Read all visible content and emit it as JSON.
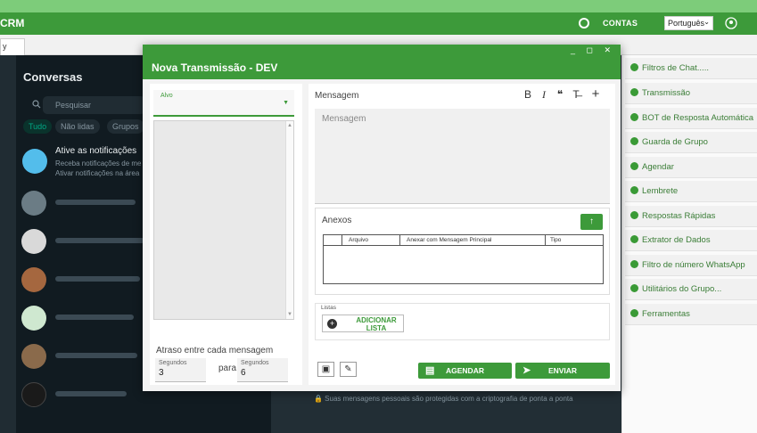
{
  "topbar": {
    "app_title": "CRM",
    "contas_label": "CONTAS",
    "language": "Português"
  },
  "tab": {
    "label": "y"
  },
  "whatsapp": {
    "title": "Conversas",
    "search_placeholder": "Pesquisar",
    "filters": [
      "Tudo",
      "Não lidas",
      "Grupos"
    ],
    "notification": {
      "title": "Ative as notificações",
      "line1": "Receba notificações de me",
      "line2": "Ativar notificações na área"
    },
    "privacy_note": "🔒 Suas mensagens pessoais são protegidas com a criptografia de ponta a ponta"
  },
  "modal": {
    "title": "Nova Transmissão - DEV",
    "window_controls": "_ ◻ ✕",
    "alvo_label": "Alvo",
    "delay_label": "Atraso entre cada mensagem",
    "delay_from_caption": "Segundos",
    "delay_from_value": "3",
    "delay_between": "para",
    "delay_to_caption": "Segundos",
    "delay_to_value": "6",
    "message_label": "Mensagem",
    "message_placeholder": "Mensagem",
    "format_buttons": [
      "B",
      "I",
      "❝",
      "T̶",
      "+"
    ],
    "anexos_label": "Anexos",
    "table_headers": [
      "Arquivo",
      "Anexar com Mensagem Principal",
      "Tipo"
    ],
    "listas_label": "Listas",
    "add_list_label": "ADICIONAR LISTA",
    "agendar_label": "AGENDAR",
    "enviar_label": "ENVIAR"
  },
  "right_panel": {
    "items": [
      "Filtros de Chat.....",
      "Transmissão",
      "BOT de Resposta Automática",
      "Guarda de Grupo",
      "Agendar",
      "Lembrete",
      "Respostas Rápidas",
      "Extrator de Dados",
      "Filtro de número WhatsApp",
      "Utilitários do Grupo...",
      "Ferramentas"
    ]
  },
  "colors": {
    "brand_green": "#3d9a3a",
    "light_green": "#7dcc7a",
    "wa_dark": "#111b21"
  }
}
